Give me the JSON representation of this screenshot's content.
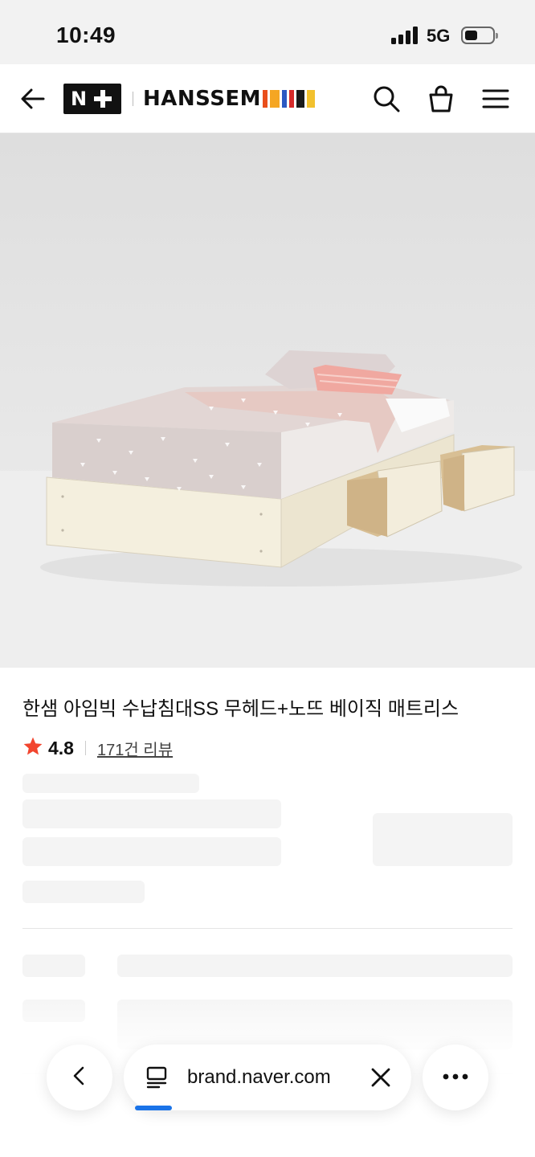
{
  "status_bar": {
    "time": "10:49",
    "network": "5G",
    "battery_level_percent": 45
  },
  "header": {
    "back_icon": "arrow-left-icon",
    "nplus_logo": "N+",
    "brand_logo_text": "HANSSEM",
    "brand_bar_colors": [
      "#e94e1b",
      "#f5a623",
      "#2b59c3",
      "#d62b2b",
      "#1a1a1a",
      "#f2c12e"
    ],
    "search_icon": "search-icon",
    "cart_icon": "shopping-bag-icon",
    "menu_icon": "hamburger-menu-icon"
  },
  "product": {
    "title": "한샘 아임빅 수납침대SS 무헤드+노뜨 베이직 매트리스",
    "rating": "4.8",
    "review_link": "171건 리뷰",
    "star_color": "#f2452e"
  },
  "browser_bar": {
    "back_icon": "chevron-left-icon",
    "page_icon": "page-icon",
    "url": "brand.naver.com",
    "close_icon": "close-icon",
    "more_icon": "more-dots-icon"
  }
}
